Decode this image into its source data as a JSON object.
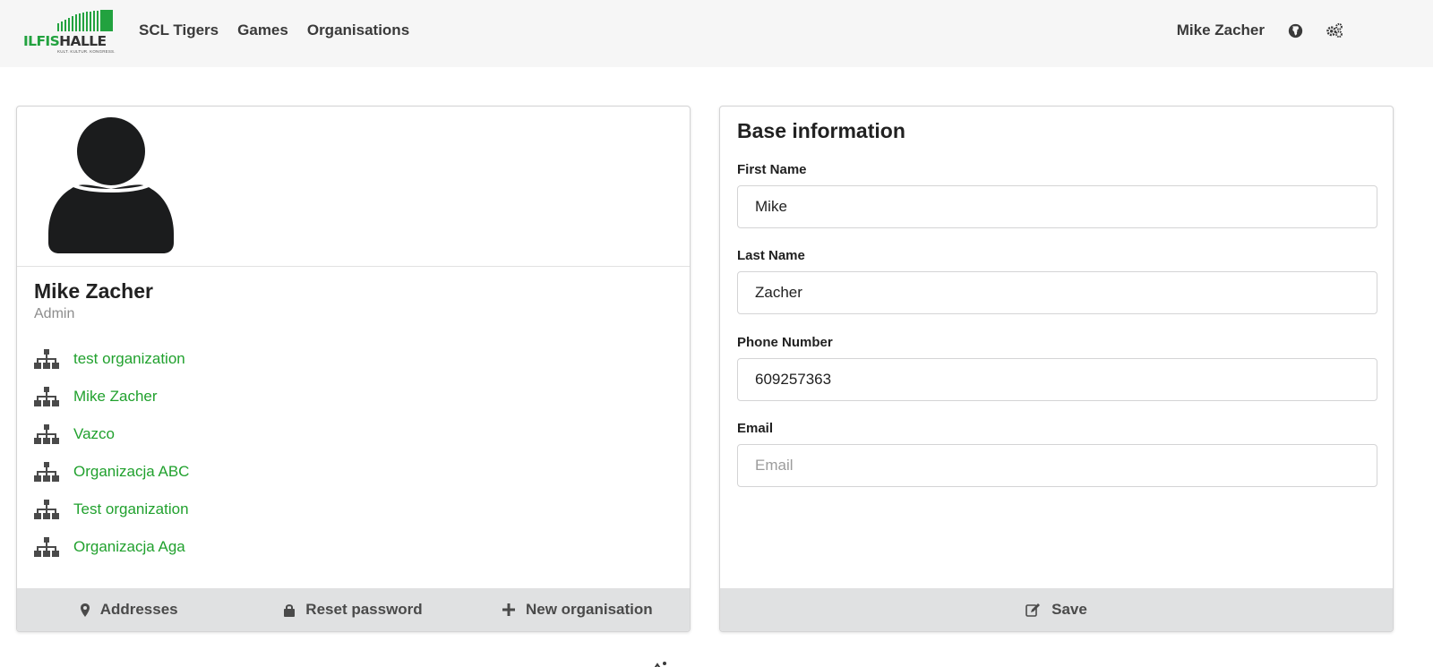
{
  "brand": {
    "logo_word_part1": "ILFIS",
    "logo_word_part2": "HALLE",
    "logo_tagline": "KULT. KULTUR. KONGRESS."
  },
  "navbar": {
    "links": [
      {
        "label": "SCL Tigers"
      },
      {
        "label": "Games"
      },
      {
        "label": "Organisations"
      }
    ],
    "user_name": "Mike Zacher",
    "icons": [
      "globe-icon",
      "settings-gears-icon"
    ]
  },
  "profile": {
    "name": "Mike Zacher",
    "role": "Admin",
    "organizations": [
      {
        "label": "test organization",
        "icon": "sitemap-icon"
      },
      {
        "label": "Mike Zacher",
        "icon": "sitemap-icon"
      },
      {
        "label": "Vazco",
        "icon": "sitemap-icon"
      },
      {
        "label": "Organizacja ABC",
        "icon": "sitemap-icon"
      },
      {
        "label": "Test organization",
        "icon": "sitemap-icon"
      },
      {
        "label": "Organizacja Aga",
        "icon": "sitemap-icon"
      }
    ],
    "footer": {
      "addresses_label": "Addresses",
      "reset_password_label": "Reset password",
      "new_organisation_label": "New organisation"
    }
  },
  "form": {
    "title": "Base information",
    "first_name": {
      "label": "First Name",
      "value": "Mike",
      "placeholder": "First Name"
    },
    "last_name": {
      "label": "Last Name",
      "value": "Zacher",
      "placeholder": "Last Name"
    },
    "phone": {
      "label": "Phone Number",
      "value": "609257363",
      "placeholder": "Phone Number"
    },
    "email": {
      "label": "Email",
      "value": "",
      "placeholder": "Email"
    },
    "save_label": "Save"
  },
  "colors": {
    "accent_green": "#21a12e",
    "navbar_bg": "#f6f6f6",
    "footer_bg": "#e0e1e2"
  }
}
